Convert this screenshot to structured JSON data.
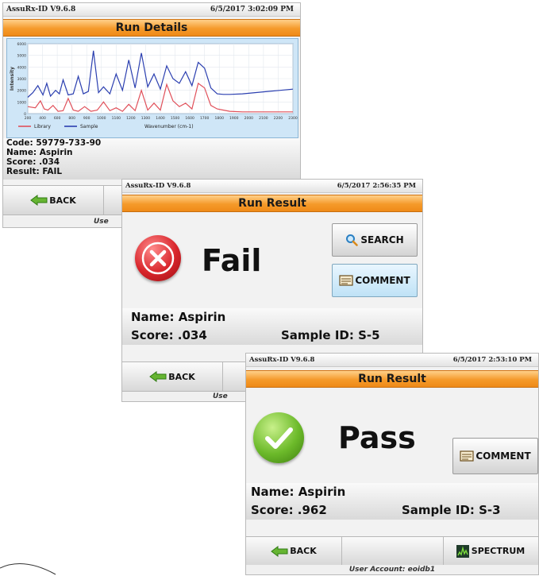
{
  "details": {
    "app_version": "AssuRx-ID V9.6.8",
    "timestamp": "6/5/2017 3:02:09 PM",
    "title": "Run Details",
    "code": "Code: 59779-733-90",
    "name": "Name: Aspirin",
    "score": "Score: .034",
    "result": "Result: FAIL",
    "back_label": "BACK",
    "user_account_partial": "Use"
  },
  "fail": {
    "app_version": "AssuRx-ID V9.6.8",
    "timestamp": "6/5/2017 2:56:35 PM",
    "title": "Run Result",
    "status": "Fail",
    "search_label": "SEARCH",
    "comment_label": "COMMENT",
    "name": "Name: Aspirin",
    "score": "Score: .034",
    "sample_id": "Sample ID: S-5",
    "back_label": "BACK",
    "user_account_partial": "Use"
  },
  "pass": {
    "app_version": "AssuRx-ID V9.6.8",
    "timestamp": "6/5/2017 2:53:10 PM",
    "title": "Run Result",
    "status": "Pass",
    "comment_label": "COMMENT",
    "name": "Name: Aspirin",
    "score": "Score: .962",
    "sample_id": "Sample ID: S-3",
    "back_label": "BACK",
    "spectrum_label": "SPECTRUM",
    "user_account": "User Account: eoidb1"
  },
  "colors": {
    "title_bar": "#f59a2a",
    "fail_red": "#d8252b",
    "pass_green": "#6cba2a",
    "library_series": "#e0505a",
    "sample_series": "#2b3fb0"
  },
  "chart_data": {
    "type": "line",
    "ylabel": "Intensity",
    "xlabel": "Wavenumber (cm-1)",
    "legend_position": "bottom-left",
    "grid": true,
    "y_tick_labels": [
      "6000",
      "5000",
      "4000",
      "3000",
      "2000",
      "1000",
      "0"
    ],
    "x_tick_labels": [
      "200",
      "400",
      "600",
      "800",
      "900",
      "1000",
      "1100",
      "1200",
      "1300",
      "1400",
      "1500",
      "1600",
      "1700",
      "1800",
      "1900",
      "2000",
      "2100",
      "2200",
      "2300"
    ],
    "xlim": [
      200,
      2300
    ],
    "ylim": [
      0,
      6000
    ],
    "series": [
      {
        "name": "Library",
        "x": [
          200,
          260,
          300,
          330,
          360,
          400,
          440,
          480,
          520,
          560,
          600,
          650,
          700,
          750,
          800,
          850,
          900,
          950,
          1000,
          1050,
          1100,
          1150,
          1200,
          1250,
          1300,
          1350,
          1400,
          1450,
          1500,
          1550,
          1600,
          1650,
          1700,
          1750,
          1800,
          1900,
          2000,
          2100,
          2200,
          2300
        ],
        "y": [
          600,
          500,
          1100,
          400,
          300,
          700,
          200,
          250,
          1300,
          300,
          200,
          600,
          200,
          300,
          1000,
          250,
          500,
          200,
          800,
          250,
          2000,
          300,
          900,
          300,
          2500,
          1100,
          600,
          900,
          400,
          2600,
          2200,
          700,
          400,
          300,
          200,
          150,
          150,
          150,
          150,
          150
        ]
      },
      {
        "name": "Sample",
        "x": [
          200,
          240,
          280,
          320,
          350,
          380,
          420,
          450,
          480,
          520,
          560,
          600,
          640,
          680,
          720,
          760,
          800,
          850,
          900,
          950,
          1000,
          1050,
          1100,
          1150,
          1200,
          1250,
          1300,
          1350,
          1400,
          1450,
          1500,
          1550,
          1600,
          1650,
          1700,
          1750,
          1800,
          1900,
          2000,
          2100,
          2200,
          2300
        ],
        "y": [
          1400,
          1800,
          2400,
          1600,
          2600,
          1500,
          2000,
          1700,
          2900,
          1600,
          1700,
          3200,
          1700,
          1900,
          5400,
          1800,
          2300,
          1700,
          3400,
          2000,
          4600,
          2200,
          5200,
          2300,
          3400,
          2100,
          4100,
          3000,
          2600,
          3600,
          2400,
          4400,
          3900,
          2200,
          1700,
          1650,
          1650,
          1700,
          1800,
          1900,
          2000,
          2100
        ]
      }
    ]
  }
}
